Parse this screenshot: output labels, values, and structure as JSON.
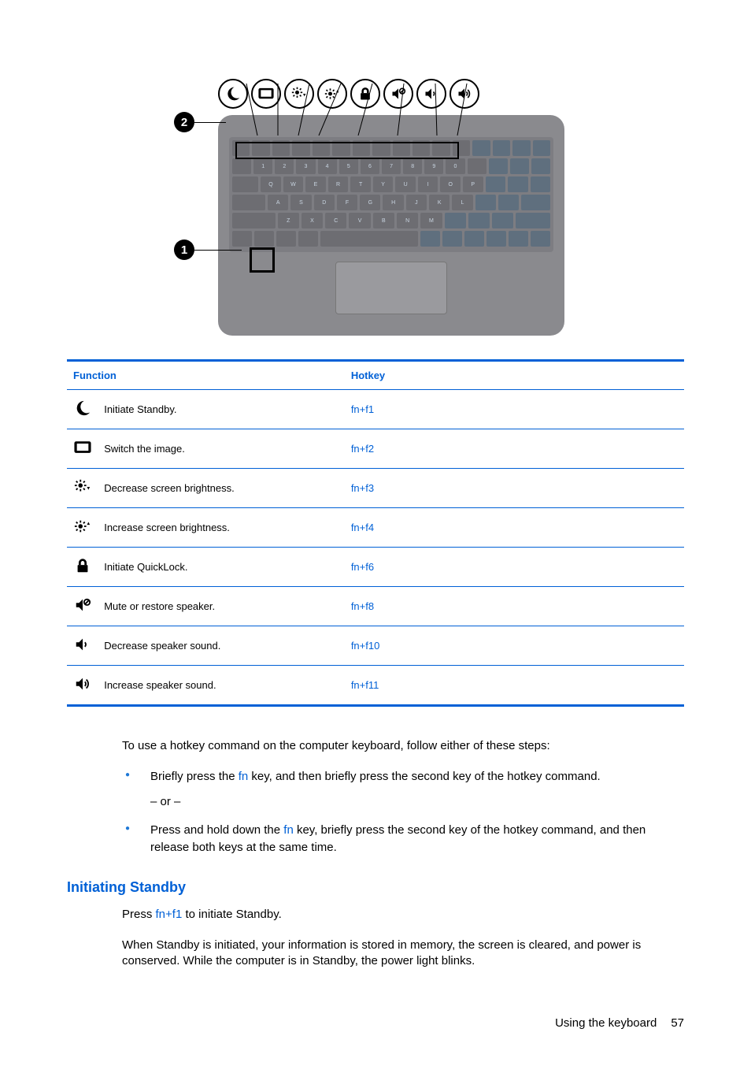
{
  "diagram": {
    "icons": [
      "moon",
      "display",
      "brightness-down",
      "brightness-up",
      "lock",
      "volume-mute",
      "volume-down",
      "volume-up"
    ],
    "callouts": [
      "1",
      "2"
    ]
  },
  "table": {
    "headers": {
      "function": "Function",
      "hotkey": "Hotkey"
    },
    "rows": [
      {
        "icon": "moon",
        "fn": "Initiate Standby.",
        "hk": "fn+f1"
      },
      {
        "icon": "display",
        "fn": "Switch the image.",
        "hk": "fn+f2"
      },
      {
        "icon": "brightness-down",
        "fn": "Decrease screen brightness.",
        "hk": "fn+f3"
      },
      {
        "icon": "brightness-up",
        "fn": "Increase screen brightness.",
        "hk": "fn+f4"
      },
      {
        "icon": "lock",
        "fn": "Initiate QuickLock.",
        "hk": "fn+f6"
      },
      {
        "icon": "volume-mute",
        "fn": "Mute or restore speaker.",
        "hk": "fn+f8"
      },
      {
        "icon": "volume-down",
        "fn": "Decrease speaker sound.",
        "hk": "fn+f10"
      },
      {
        "icon": "volume-up",
        "fn": "Increase speaker sound.",
        "hk": "fn+f11"
      }
    ]
  },
  "intro": "To use a hotkey command on the computer keyboard, follow either of these steps:",
  "fn_word": "fn",
  "steps": {
    "a_pre": "Briefly press the ",
    "a_post": " key, and then briefly press the second key of the hotkey command.",
    "or": "– or –",
    "b_pre": "Press and hold down the ",
    "b_post": " key, briefly press the second key of the hotkey command, and then release both keys at the same time."
  },
  "section_heading": "Initiating Standby",
  "standby": {
    "p1_pre": "Press ",
    "p1_key": "fn+f1",
    "p1_post": " to initiate Standby.",
    "p2": "When Standby is initiated, your information is stored in memory, the screen is cleared, and power is conserved. While the computer is in Standby, the power light blinks."
  },
  "footer": {
    "label": "Using the keyboard",
    "page": "57"
  }
}
